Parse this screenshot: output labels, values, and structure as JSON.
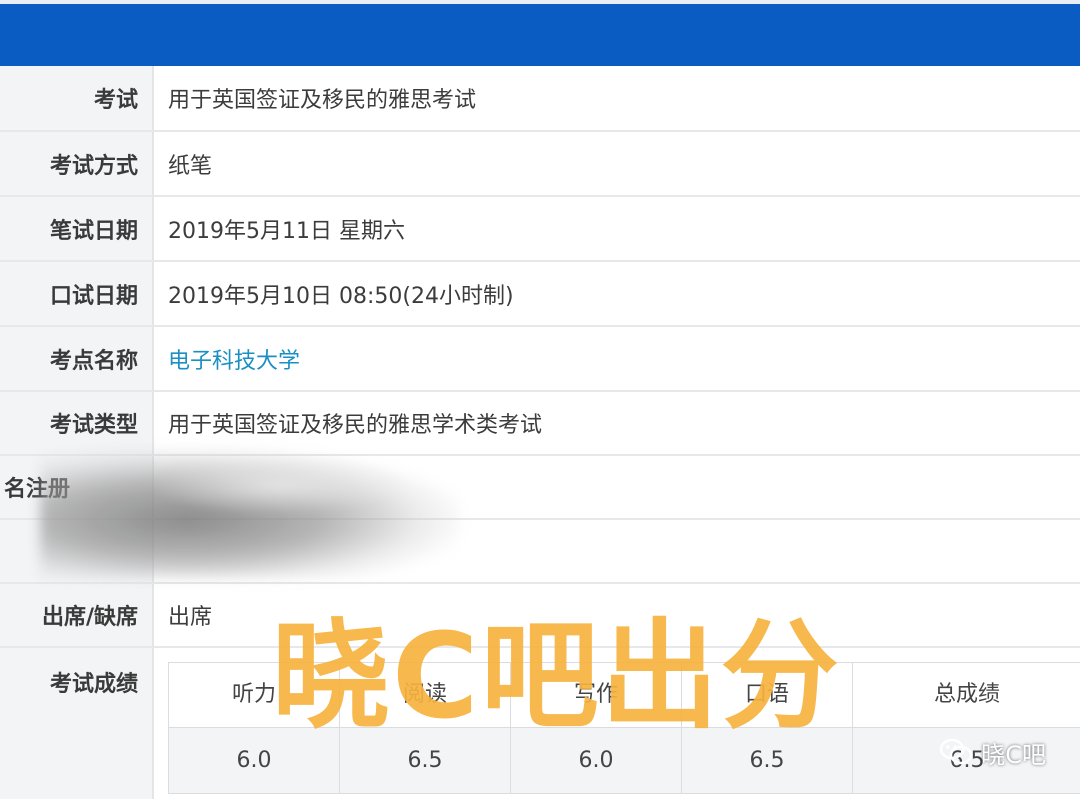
{
  "rows": {
    "exam": {
      "label": "考试",
      "value": "用于英国签证及移民的雅思考试"
    },
    "mode": {
      "label": "考试方式",
      "value": "纸笔"
    },
    "written_date": {
      "label": "笔试日期",
      "value": "2019年5月11日 星期六"
    },
    "speaking_date": {
      "label": "口试日期",
      "value": "2019年5月10日 08:50(24小时制)"
    },
    "venue": {
      "label": "考点名称",
      "value": "电子科技大学"
    },
    "exam_type": {
      "label": "考试类型",
      "value": "用于英国签证及移民的雅思学术类考试"
    },
    "registration": {
      "label": "名注册"
    },
    "attendance": {
      "label": "出席/缺席",
      "value": "出席"
    },
    "scores": {
      "label": "考试成绩"
    }
  },
  "score_table": {
    "headers": [
      "听力",
      "阅读",
      "写作",
      "口语",
      "总成绩"
    ],
    "values": [
      "6.0",
      "6.5",
      "6.0",
      "6.5",
      "6.5"
    ]
  },
  "watermark": {
    "text": "晓C吧出分"
  },
  "wechat_tag": {
    "text": "晓C吧",
    "icon": "wechat-icon"
  },
  "colors": {
    "header": "#0a5cc2",
    "link": "#1a8fc4",
    "watermark": "#f6b23e"
  }
}
